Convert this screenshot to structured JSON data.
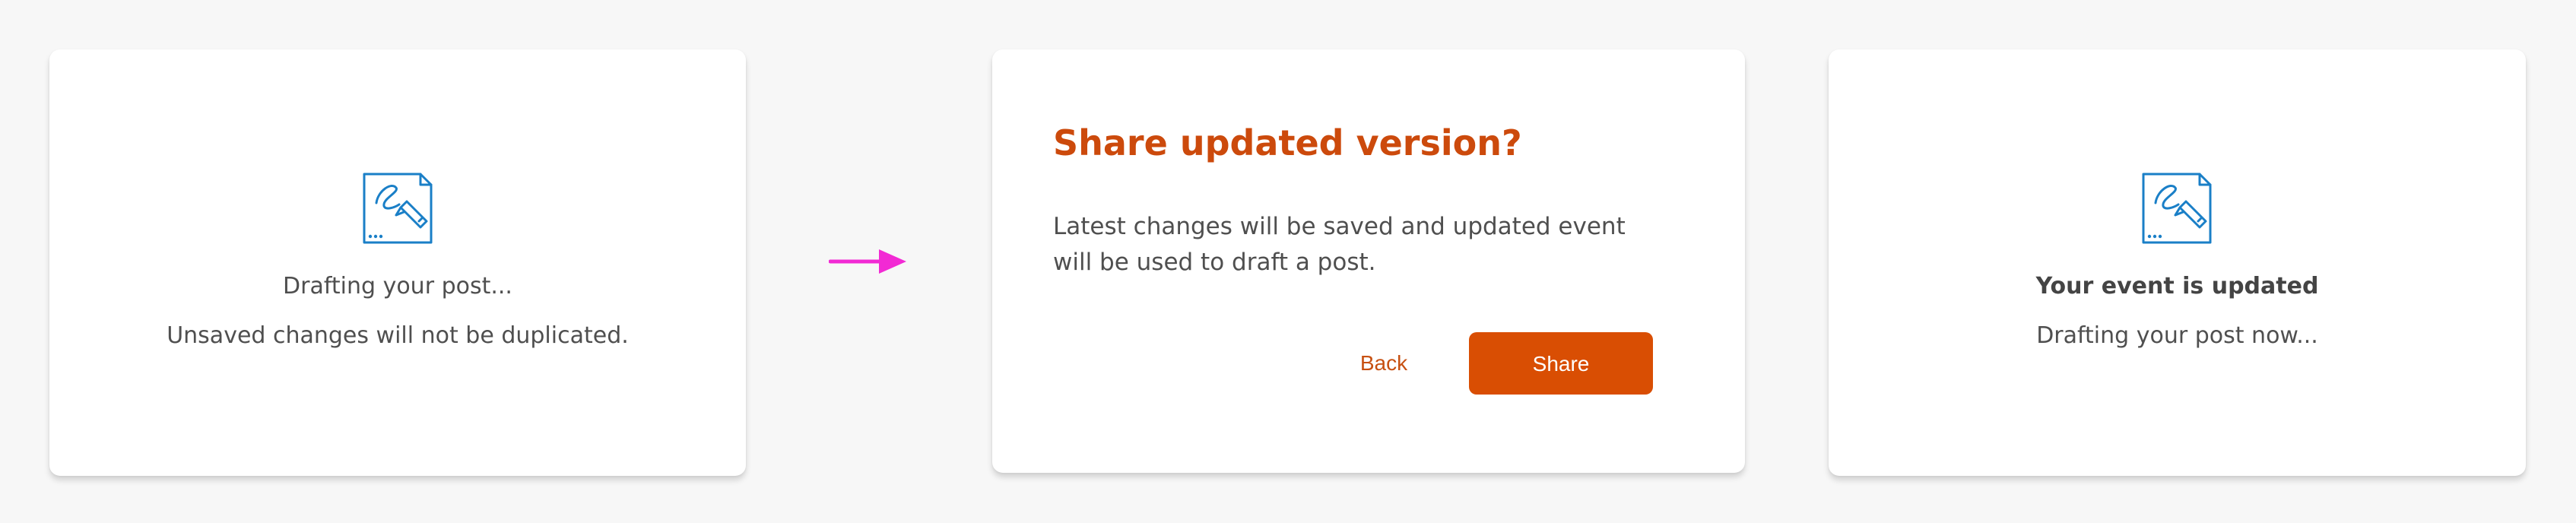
{
  "colors": {
    "background": "#f7f7f7",
    "card": "#ffffff",
    "accent": "#d94e03",
    "title": "#cc4a0c",
    "icon": "#1a7fc7",
    "arrow": "#f22ad4",
    "text": "#4f4f4f"
  },
  "drafting_card": {
    "icon": "document-pen-icon",
    "status": "Drafting your post...",
    "note": "Unsaved changes will not be duplicated."
  },
  "flow_arrow": {
    "icon": "arrow-right-icon"
  },
  "share_dialog": {
    "title": "Share updated version?",
    "body": "Latest changes will be saved and updated event will be used to draft a post.",
    "back_label": "Back",
    "share_label": "Share"
  },
  "updated_card": {
    "icon": "document-pen-icon",
    "status": "Your event is updated",
    "note": "Drafting your post now..."
  }
}
